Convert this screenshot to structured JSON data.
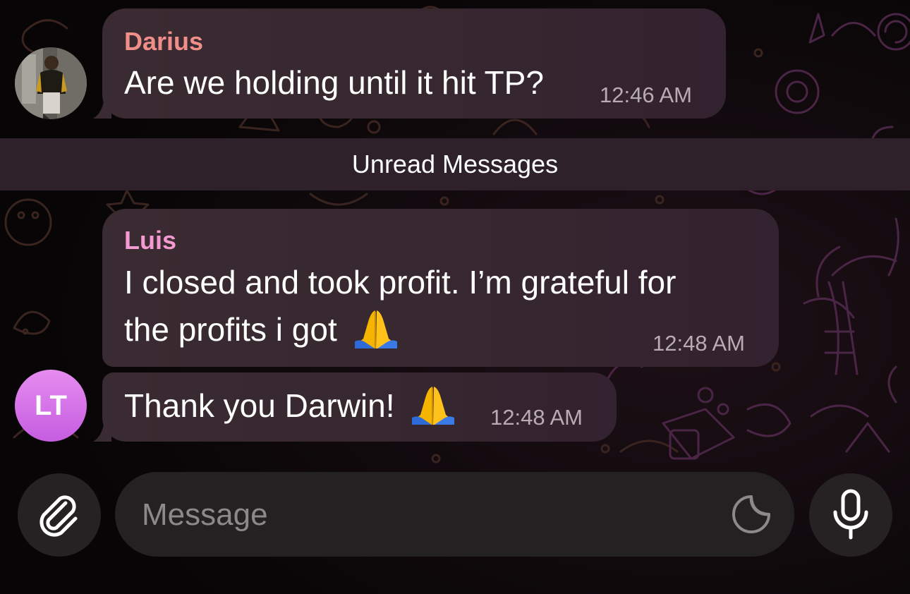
{
  "messages": [
    {
      "sender": "Darius",
      "sender_color": "#f08f8a",
      "text": "Are we holding until it hit TP?",
      "time": "12:46 AM",
      "avatar_icon": "user-photo"
    },
    {
      "sender": "Luis",
      "sender_color": "#f49ad0",
      "line1": "I closed and took profit. I’m grateful for",
      "line2": "the profits i got",
      "emoji_icon": "folded-hands-emoji",
      "time": "12:48 AM"
    },
    {
      "text": "Thank you Darwin!",
      "emoji_icon": "folded-hands-emoji",
      "time": "12:48 AM",
      "avatar_initials": "LT"
    }
  ],
  "unread_divider": "Unread Messages",
  "composer": {
    "placeholder": "Message",
    "attach_icon": "paperclip-icon",
    "sticker_icon": "sticker-icon",
    "mic_icon": "microphone-icon"
  },
  "colors": {
    "bubble": "#37272f",
    "divider": "#2e2129",
    "timestamp": "#b8acb2",
    "avatar_gradient": [
      "#e68cf0",
      "#c55de0"
    ]
  }
}
